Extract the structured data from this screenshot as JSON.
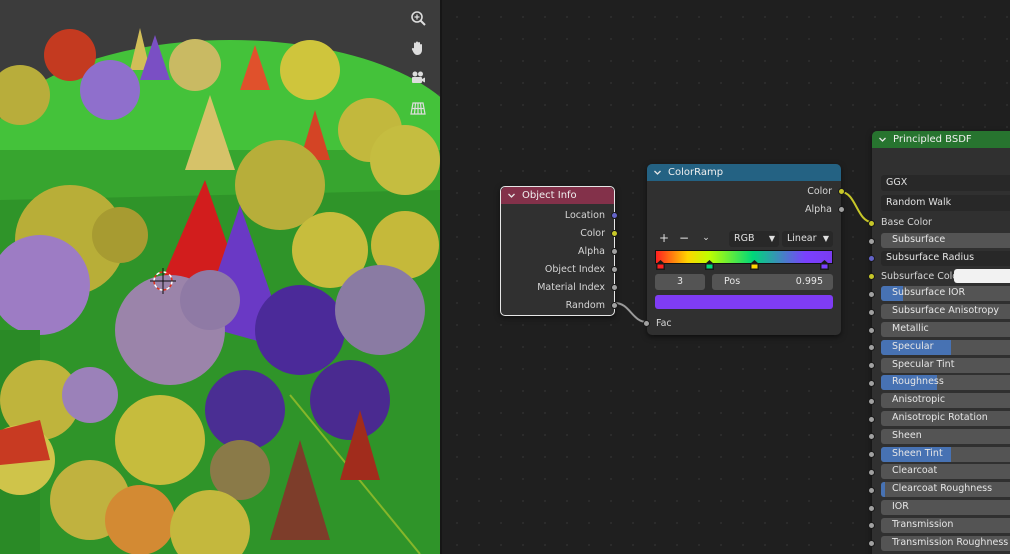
{
  "viewport": {
    "tools": [
      {
        "name": "zoom-icon"
      },
      {
        "name": "pan-hand-icon"
      },
      {
        "name": "camera-icon"
      },
      {
        "name": "grid-perspective-icon"
      }
    ]
  },
  "nodes": {
    "object_info": {
      "title": "Object Info",
      "header_color": "#83314a",
      "outputs": [
        {
          "label": "Location",
          "socket": "blue"
        },
        {
          "label": "Color",
          "socket": "yellow"
        },
        {
          "label": "Alpha",
          "socket": "grey"
        },
        {
          "label": "Object Index",
          "socket": "grey"
        },
        {
          "label": "Material Index",
          "socket": "grey"
        },
        {
          "label": "Random",
          "socket": "grey"
        }
      ]
    },
    "color_ramp": {
      "title": "ColorRamp",
      "header_color": "#246283",
      "outputs": [
        {
          "label": "Color",
          "socket": "yellow"
        },
        {
          "label": "Alpha",
          "socket": "grey"
        }
      ],
      "add_label": "+",
      "remove_label": "−",
      "menu_label": "⌄",
      "color_mode": "RGB",
      "interpolation": "Linear",
      "active_index": "3",
      "pos_label": "Pos",
      "pos_value": "0.995",
      "stop_colors": [
        "#ff2020",
        "#00d77a",
        "#ffd500",
        "#7a40ff"
      ],
      "swatch_color": "#7f3cf5",
      "input": {
        "label": "Fac",
        "socket": "grey"
      }
    },
    "bsdf": {
      "title": "Principled BSDF",
      "header_color": "#27742f",
      "distribution": "GGX",
      "subsurface_method": "Random Walk",
      "base_color_label": "Base Color",
      "inputs": [
        {
          "label": "Subsurface",
          "socket": "grey",
          "fill": 0
        },
        {
          "label": "Subsurface Radius",
          "socket": "blue",
          "type": "vector"
        },
        {
          "label": "Subsurface Colo",
          "socket": "yellow",
          "type": "color",
          "color": "#f2f2f2"
        },
        {
          "label": "Subsurface IOR",
          "socket": "grey",
          "fill": 0.16
        },
        {
          "label": "Subsurface Anisotropy",
          "socket": "grey",
          "fill": 0
        },
        {
          "label": "Metallic",
          "socket": "grey",
          "fill": 0
        },
        {
          "label": "Specular",
          "socket": "grey",
          "fill": 0.5
        },
        {
          "label": "Specular Tint",
          "socket": "grey",
          "fill": 0
        },
        {
          "label": "Roughness",
          "socket": "grey",
          "fill": 0.4
        },
        {
          "label": "Anisotropic",
          "socket": "grey",
          "fill": 0
        },
        {
          "label": "Anisotropic Rotation",
          "socket": "grey",
          "fill": 0
        },
        {
          "label": "Sheen",
          "socket": "grey",
          "fill": 0
        },
        {
          "label": "Sheen Tint",
          "socket": "grey",
          "fill": 0.5
        },
        {
          "label": "Clearcoat",
          "socket": "grey",
          "fill": 0
        },
        {
          "label": "Clearcoat Roughness",
          "socket": "grey",
          "fill": 0.03
        },
        {
          "label": "IOR",
          "socket": "grey",
          "fill": 0
        },
        {
          "label": "Transmission",
          "socket": "grey",
          "fill": 0
        },
        {
          "label": "Transmission Roughness",
          "socket": "grey",
          "fill": 0
        }
      ]
    }
  }
}
